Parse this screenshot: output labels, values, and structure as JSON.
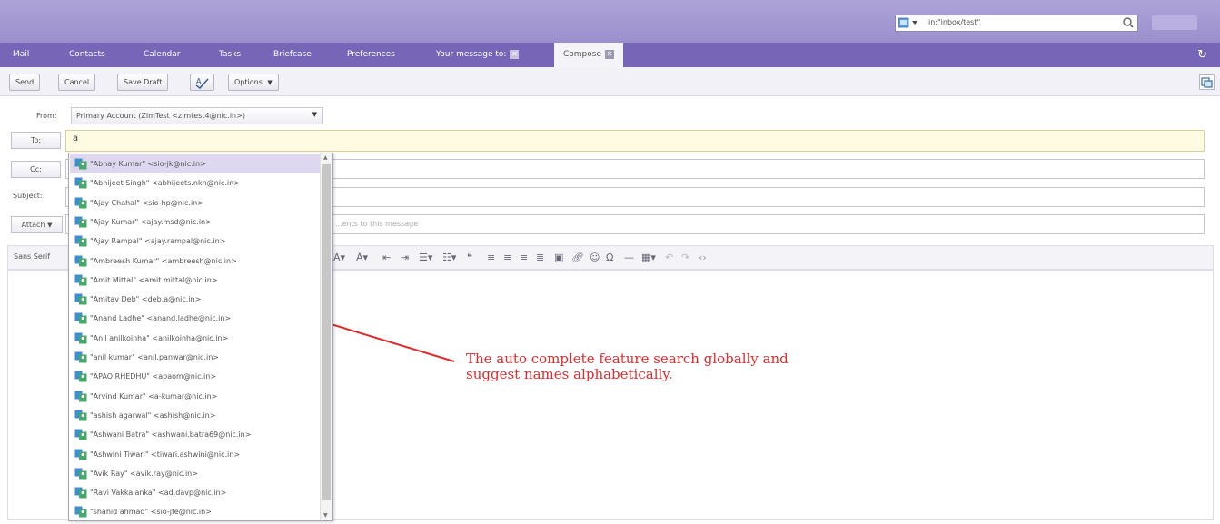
{
  "search": {
    "value": "in:\"inbox/test\""
  },
  "tabs": [
    {
      "label": "Mail"
    },
    {
      "label": "Contacts"
    },
    {
      "label": "Calendar"
    },
    {
      "label": "Tasks"
    },
    {
      "label": "Briefcase"
    },
    {
      "label": "Preferences"
    },
    {
      "label": "Your message to:"
    },
    {
      "label": "Compose"
    }
  ],
  "toolbar": {
    "send": "Send",
    "cancel": "Cancel",
    "save_draft": "Save Draft",
    "options": "Options"
  },
  "compose": {
    "from_label": "From:",
    "from_value": "Primary Account (ZimTest <zimtest4@nic.in>)",
    "to_button": "To:",
    "to_value": "a",
    "cc_button": "Cc:",
    "subject_label": "Subject:",
    "attach_button": "Attach",
    "attach_hint": "...ents to this message",
    "font_family": "Sans Serif"
  },
  "autocomplete": [
    "\"Abhay Kumar\" <sio-jk@nic.in>",
    "\"Abhijeet Singh\" <abhijeets.nkn@nic.in>",
    "\"Ajay Chahal\" <sio-hp@nic.in>",
    "\"Ajay Kumar\" <ajay.msd@nic.in>",
    "\"Ajay Rampal\" <ajay.rampal@nic.in>",
    "\"Ambreesh Kumar\" <ambreesh@nic.in>",
    "\"Amit Mittal\" <amit.mittal@nic.in>",
    "\"Amitav Deb\" <deb.a@nic.in>",
    "\"Anand Ladhe\" <anand.ladhe@nic.in>",
    "\"Anil anilkoinha\" <anilkoinha@nic.in>",
    "\"anil kumar\" <anil.panwar@nic.in>",
    "\"APAO RHEDHU\" <apaom@nic.in>",
    "\"Arvind Kumar\" <a-kumar@nic.in>",
    "\"ashish agarwal\" <ashish@nic.in>",
    "\"Ashwani Batra\" <ashwani.batra69@nic.in>",
    "\"Ashwini Tiwari\" <tiwari.ashwini@nic.in>",
    "\"Avik Ray\" <avik.ray@nic.in>",
    "\"Ravi Vakkalanka\" <ad.davp@nic.in>",
    "\"shahid ahmad\" <sio-jfe@nic.in>"
  ],
  "annotation": {
    "line1": "The auto complete feature search globally and",
    "line2": "suggest names alphabetically."
  },
  "colors": {
    "header": "#9a8fcc",
    "tabbar": "#7765b7",
    "annotation": "#e02b2b"
  }
}
